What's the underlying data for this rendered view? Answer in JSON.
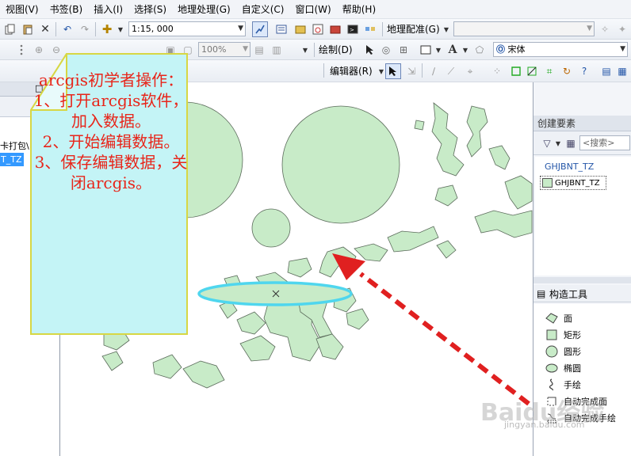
{
  "menu": [
    "视图(V)",
    "书签(B)",
    "插入(I)",
    "选择(S)",
    "地理处理(G)",
    "自定义(C)",
    "窗口(W)",
    "帮助(H)"
  ],
  "toolbar1": {
    "scale": "1:15, 000",
    "georef_label": "地理配准(G)",
    "georef_combo": ""
  },
  "toolbar2": {
    "zoom": "100%",
    "draw_label": "绘制(D)",
    "font": "宋体"
  },
  "toolbar3": {
    "editor_label": "编辑器(R)"
  },
  "left_panel": {
    "close_glyph": "□",
    "path_text": "卡打包\\",
    "selected_layer": "T_TZ"
  },
  "right_panel": {
    "create_title": "创建要素",
    "search_placeholder": "<搜索>",
    "layer_group": "GHJBNT_TZ",
    "layer_item": "GHJBNT_TZ",
    "construct_title": "构造工具",
    "tools": [
      "面",
      "矩形",
      "圆形",
      "椭圆",
      "手绘",
      "自动完成面",
      "自动完成手绘"
    ]
  },
  "note": {
    "lines": [
      "arcgis初学者操作：",
      "1、打开arcgis软件，加入数据。",
      "2、开始编辑数据。",
      "3、保存编辑数据，关闭arcgis。"
    ]
  },
  "watermark": {
    "brand": "Baidu经验",
    "url": "jingyan.baidu.com"
  },
  "colors": {
    "polygon_fill": "#c8ebc8",
    "ellipse_outline": "#4fd6ee",
    "note_fill": "#c4f4f6",
    "note_border": "#d7d744",
    "arrow_red": "#e02020"
  }
}
